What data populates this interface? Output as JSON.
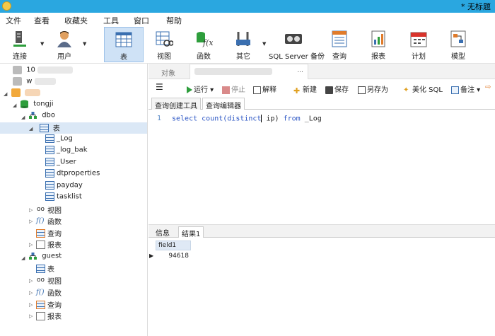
{
  "window": {
    "title": "* 无标题"
  },
  "menu": [
    "文件",
    "查看",
    "收藏夹",
    "工具",
    "窗口",
    "帮助"
  ],
  "toolbar": {
    "buttons": [
      {
        "label": "连接",
        "icon": "connection-icon"
      },
      {
        "label": "用户",
        "icon": "user-icon"
      },
      {
        "label": "表",
        "icon": "table-icon"
      },
      {
        "label": "视图",
        "icon": "view-icon"
      },
      {
        "label": "函数",
        "icon": "function-icon"
      },
      {
        "label": "其它",
        "icon": "tools-icon"
      },
      {
        "label": "SQL Server 备份",
        "icon": "backup-icon"
      },
      {
        "label": "查询",
        "icon": "query-icon"
      },
      {
        "label": "报表",
        "icon": "report-icon"
      },
      {
        "label": "计划",
        "icon": "schedule-icon"
      },
      {
        "label": "模型",
        "icon": "model-icon"
      }
    ]
  },
  "tree": {
    "conn1": "10",
    "conn2": "w",
    "db": "tongji",
    "schema_dbo": "dbo",
    "tables_label": "表",
    "tables": [
      "_Log",
      "_log_bak",
      "_User",
      "dtproperties",
      "payday",
      "tasklist"
    ],
    "dbo_children": [
      "视图",
      "函数",
      "查询",
      "报表"
    ],
    "schema_guest": "guest",
    "guest_children": [
      "表",
      "视图",
      "函数",
      "查询",
      "报表"
    ]
  },
  "editor_tabs": {
    "objects": "对象"
  },
  "query_toolbar": {
    "run": "运行",
    "stop": "停止",
    "explain": "解释",
    "new": "新建",
    "save": "保存",
    "save_as": "另存为",
    "beautify": "美化 SQL",
    "comment": "备注"
  },
  "subtabs": {
    "builder": "查询创建工具",
    "editor": "查询编辑器"
  },
  "editor": {
    "line_number": "1",
    "kw_select": "select",
    "kw_count": "count(",
    "kw_distinct": "distinct",
    "arg": " ip)",
    "kw_from": "from",
    "table": "_Log"
  },
  "result_tabs": {
    "info": "信息",
    "result": "结果1"
  },
  "results": {
    "column": "field1",
    "value": "94618"
  }
}
